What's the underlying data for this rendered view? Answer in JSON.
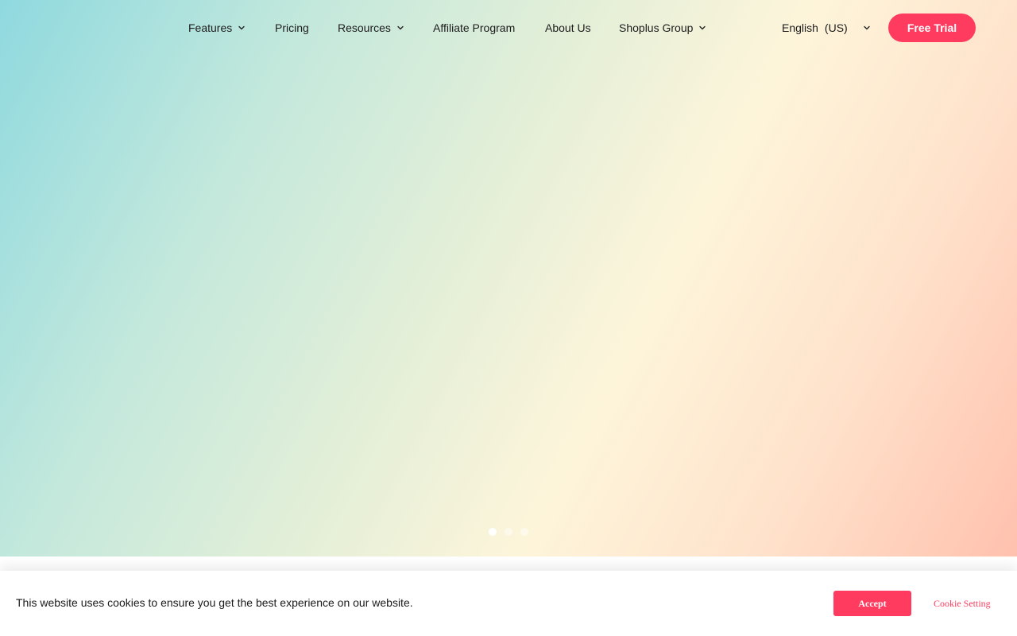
{
  "nav": {
    "items": [
      {
        "label": "Features",
        "has_dropdown": true
      },
      {
        "label": "Pricing",
        "has_dropdown": false
      },
      {
        "label": "Resources",
        "has_dropdown": true
      },
      {
        "label": "Affiliate Program",
        "has_dropdown": false
      },
      {
        "label": "About Us",
        "has_dropdown": false
      },
      {
        "label": "Shoplus Group",
        "has_dropdown": true
      }
    ],
    "language": {
      "label": "English",
      "region": "(US)"
    },
    "cta_label": "Free Trial"
  },
  "carousel": {
    "slide_count": 3,
    "active_index": 0
  },
  "cookie_banner": {
    "message": "This website uses cookies to ensure you get the best experience on our website.",
    "accept_label": "Accept",
    "settings_label": "Cookie Setting"
  },
  "colors": {
    "accent": "#ff3c5f",
    "gradient_start": "#8fd9df",
    "gradient_mid": "#fdf5da",
    "gradient_end": "#ffc1ae"
  }
}
